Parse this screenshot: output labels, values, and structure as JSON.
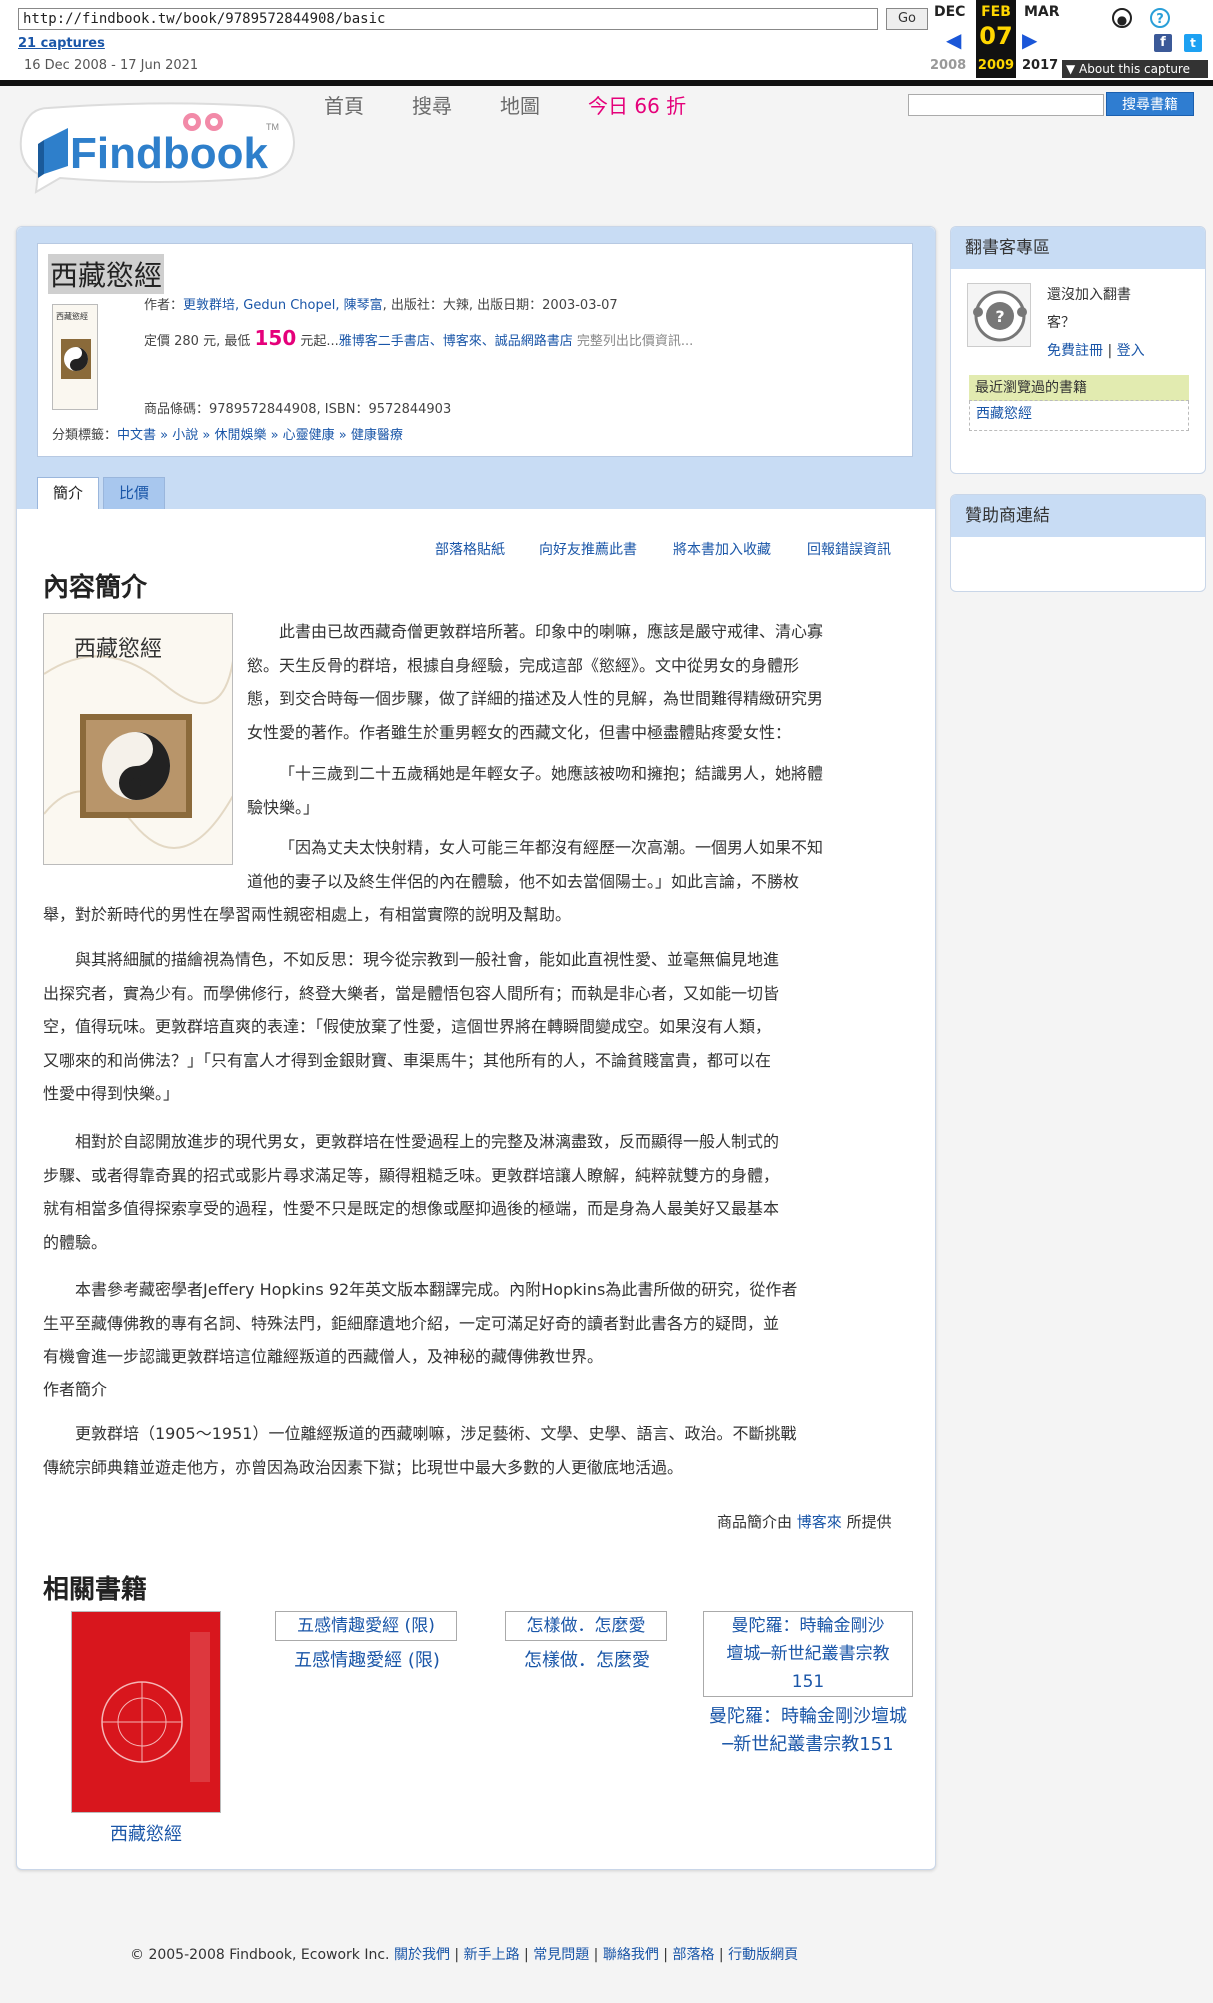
{
  "wayback": {
    "url": "http://findbook.tw/book/9789572844908/basic",
    "go_label": "Go",
    "captures": "21 captures",
    "range": "16 Dec 2008 - 17 Jun 2021",
    "months": [
      "DEC",
      "FEB",
      "MAR"
    ],
    "day": "07",
    "years": [
      "2008",
      "2009",
      "2017"
    ],
    "about": "▼ About this capture"
  },
  "site": {
    "logo_text": "Findbook",
    "logo_tm": "TM",
    "nav": [
      "首頁",
      "搜尋",
      "地圖",
      "今日 66 折"
    ],
    "search_button": "搜尋書籍"
  },
  "book": {
    "title": "西藏慾經",
    "author_line": "作者：",
    "authors": "更敦群培, Gedun Chopel, 陳琴富",
    "publisher_line": ", 出版社：大辣, 出版日期：2003-03-07",
    "price_prefix": "定價 280 元, 最低 ",
    "price_low": "150",
    "price_suffix": " 元起...",
    "stores": "雅博客二手書店、博客來、誠品網路書店",
    "price_more": " 完整列出比價資訊...",
    "barcode": "商品條碼：9789572844908, ISBN：9572844903",
    "cats_label": "分類標籤：",
    "cats": "中文書 » 小說 » 休閒娛樂 » 心靈健康 » 健康醫療",
    "cover_title": "西藏慾經"
  },
  "tabs": [
    "簡介",
    "比價"
  ],
  "actions": [
    "部落格貼紙",
    "向好友推薦此書",
    "將本書加入收藏",
    "回報錯誤資訊"
  ],
  "content": {
    "heading": "內容簡介",
    "p1_lines": [
      "此書由已故西藏奇僧更敦群培所著。印象中的喇嘛，應該是嚴守戒律、清心寡",
      "慾。天生反骨的群培，根據自身經驗，完成這部《慾經》。文中從男女的身體形",
      "態，到交合時每一個步驟，做了詳細的描述及人性的見解，為世間難得精緻研究男",
      "女性愛的著作。作者雖生於重男輕女的西藏文化，但書中極盡體貼疼愛女性："
    ],
    "q1_lines": [
      "「十三歲到二十五歲稱她是年輕女子。她應該被吻和擁抱；結識男人，她將體",
      "驗快樂。」"
    ],
    "q2_lines": [
      "「因為丈夫太快射精，女人可能三年都沒有經歷一次高潮。一個男人如果不知",
      "道他的妻子以及終生伴侶的內在體驗，他不如去當個陽士。」如此言論，不勝枚"
    ],
    "q2_tail": "舉，對於新時代的男性在學習兩性親密相處上，有相當實際的說明及幫助。",
    "p2_lines": [
      "與其將細膩的描繪視為情色，不如反思：現今從宗教到一般社會，能如此直視性愛、並毫無偏見地進",
      "出探究者，實為少有。而學佛修行，終登大樂者，當是體悟包容人間所有；而執是非心者，又如能一切皆",
      "空，值得玩味。更敦群培直爽的表達：「假使放棄了性愛，這個世界將在轉瞬間變成空。如果沒有人類，",
      "又哪來的和尚佛法？」「只有富人才得到金銀財寶、車渠馬牛；其他所有的人，不論貧賤富貴，都可以在",
      "性愛中得到快樂。」"
    ],
    "p3_lines": [
      "相對於自認開放進步的現代男女，更敦群培在性愛過程上的完整及淋漓盡致，反而顯得一般人制式的",
      "步驟、或者得靠奇異的招式或影片尋求滿足等，顯得粗糙乏味。更敦群培讓人瞭解，純粹就雙方的身體，",
      "就有相當多值得探索享受的過程，性愛不只是既定的想像或壓抑過後的極端，而是身為人最美好又最基本",
      "的體驗。"
    ],
    "p4_lines": [
      "本書參考藏密學者Jeffery Hopkins 92年英文版本翻譯完成。內附Hopkins為此書所做的研究，從作者",
      "生平至藏傳佛教的專有名詞、特殊法門，鉅細靡遺地介紹，一定可滿足好奇的讀者對此書各方的疑問，並",
      "有機會進一步認識更敦群培這位離經叛道的西藏僧人，及神秘的藏傳佛教世界。"
    ],
    "author_heading": "作者簡介",
    "author_lines": [
      "更敦群培（1905～1951）一位離經叛道的西藏喇嘛，涉足藝術、文學、史學、語言、政治。不斷挑戰",
      "傳統宗師典籍並遊走他方，亦曾因為政治因素下獄；比現世中最大多數的人更徹底地活過。"
    ],
    "provided_prefix": "商品簡介由 ",
    "provided_by": "博客來",
    "provided_suffix": " 所提供"
  },
  "related": {
    "heading": "相關書籍",
    "items": [
      {
        "caption": "西藏慾經"
      },
      {
        "alt": "五感情趣愛經 (限)",
        "caption": "五感情趣愛經 (限)"
      },
      {
        "alt": "怎樣做．怎麼愛",
        "caption": "怎樣做．怎麼愛"
      },
      {
        "alt_lines": [
          "曼陀羅：時輪金剛沙",
          "壇城─新世紀叢書宗教",
          "151"
        ],
        "caption_lines": [
          "曼陀羅：時輪金剛沙壇城",
          "─新世紀叢書宗教151"
        ]
      }
    ]
  },
  "sidebar": {
    "blogger_heading": "翻書客專區",
    "not_joined_1": "還沒加入翻書",
    "not_joined_2": "客？",
    "register": "免費註冊",
    "login": "登入",
    "recent_heading": "最近瀏覽過的書籍",
    "recent_item": "西藏慾經",
    "sponsor_heading": "贊助商連結"
  },
  "footer": {
    "copyright": "© 2005-2008 Findbook, Ecowork Inc.",
    "links": [
      "關於我們",
      "新手上路",
      "常見問題",
      "聯絡我們",
      "部落格",
      "行動版網頁"
    ]
  },
  "colors": {
    "accent_blue": "#1a56a8",
    "price_pink": "#e5007a",
    "band_blue": "#c8dcf4"
  }
}
